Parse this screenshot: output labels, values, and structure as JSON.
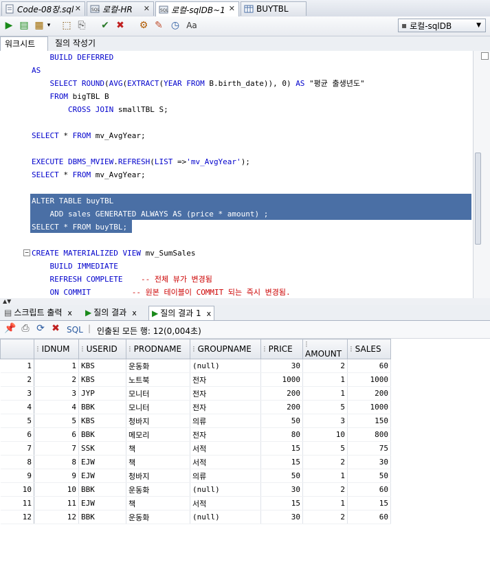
{
  "tabs": [
    {
      "label": "Code-08장.sql",
      "active": false
    },
    {
      "label": "로컬-HR",
      "active": false
    },
    {
      "label": "로컬-sqlDB~1",
      "active": true
    },
    {
      "label": "BUYTBL",
      "active": false
    }
  ],
  "toolbar": {
    "connection": "로컬-sqlDB"
  },
  "subtabs": {
    "worksheet": "워크시트",
    "builder": "질의 작성기"
  },
  "code": [
    {
      "text": "    BUILD DEFERRED"
    },
    {
      "text": "AS"
    },
    {
      "text": "    SELECT ROUND(AVG(EXTRACT(YEAR FROM B.birth_date)), 0) AS \"평균 출생년도\""
    },
    {
      "text": "    FROM bigTBL B"
    },
    {
      "text": "        CROSS JOIN smallTBL S;"
    },
    {
      "text": ""
    },
    {
      "text": "SELECT * FROM mv_AvgYear;"
    },
    {
      "text": ""
    },
    {
      "text": "EXECUTE DBMS_MVIEW.REFRESH(LIST =>'mv_AvgYear');"
    },
    {
      "text": "SELECT * FROM mv_AvgYear;"
    },
    {
      "text": ""
    },
    {
      "text": "ALTER TABLE buyTBL"
    },
    {
      "text": "    ADD sales GENERATED ALWAYS AS (price * amount) ;"
    },
    {
      "text": "SELECT * FROM buyTBL;"
    },
    {
      "text": ""
    },
    {
      "text": "CREATE MATERIALIZED VIEW mv_SumSales"
    },
    {
      "text": "    BUILD IMMEDIATE"
    },
    {
      "text": "    REFRESH COMPLETE    -- 전체 뷰가 변경됨"
    },
    {
      "text": "    ON COMMIT         -- 원본 테이블이 COMMIT 되는 즉시 변경됨."
    }
  ],
  "result_tabs": [
    {
      "label": "스크립트 출력",
      "active": false
    },
    {
      "label": "질의 결과",
      "active": false
    },
    {
      "label": "질의 결과 1",
      "active": true
    }
  ],
  "result_toolbar": {
    "sql_label": "SQL",
    "status": "인출된 모든 행: 12(0,004초)"
  },
  "columns": [
    "IDNUM",
    "USERID",
    "PRODNAME",
    "GROUPNAME",
    "PRICE",
    "AMOUNT",
    "SALES"
  ],
  "rows": [
    [
      "1",
      "1",
      "KBS",
      "운동화",
      "(null)",
      "30",
      "2",
      "60"
    ],
    [
      "2",
      "2",
      "KBS",
      "노트북",
      "전자",
      "1000",
      "1",
      "1000"
    ],
    [
      "3",
      "3",
      "JYP",
      "모니터",
      "전자",
      "200",
      "1",
      "200"
    ],
    [
      "4",
      "4",
      "BBK",
      "모니터",
      "전자",
      "200",
      "5",
      "1000"
    ],
    [
      "5",
      "5",
      "KBS",
      "청바지",
      "의류",
      "50",
      "3",
      "150"
    ],
    [
      "6",
      "6",
      "BBK",
      "메모리",
      "전자",
      "80",
      "10",
      "800"
    ],
    [
      "7",
      "7",
      "SSK",
      "책",
      "서적",
      "15",
      "5",
      "75"
    ],
    [
      "8",
      "8",
      "EJW",
      "책",
      "서적",
      "15",
      "2",
      "30"
    ],
    [
      "9",
      "9",
      "EJW",
      "청바지",
      "의류",
      "50",
      "1",
      "50"
    ],
    [
      "10",
      "10",
      "BBK",
      "운동화",
      "(null)",
      "30",
      "2",
      "60"
    ],
    [
      "11",
      "11",
      "EJW",
      "책",
      "서적",
      "15",
      "1",
      "15"
    ],
    [
      "12",
      "12",
      "BBK",
      "운동화",
      "(null)",
      "30",
      "2",
      "60"
    ]
  ],
  "colors": {
    "selection": "#4a6fa5",
    "keyword": "#0000cc",
    "comment": "#cc0000"
  }
}
